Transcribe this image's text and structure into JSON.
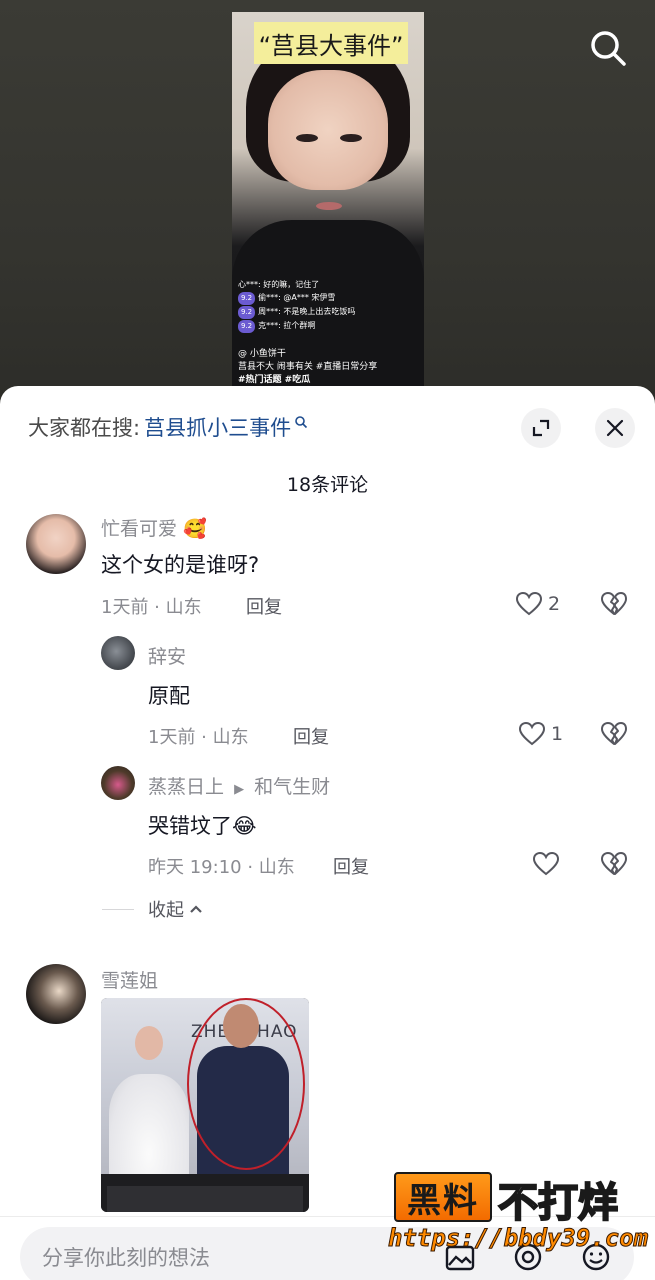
{
  "video": {
    "title_banner": "“莒县大事件”",
    "live_comments": [
      {
        "user": "心***:",
        "text": "好的嘛，记住了",
        "tag": ""
      },
      {
        "user": "偷***:",
        "text": "@A*** 宋伊雪",
        "tag": "9.2"
      },
      {
        "user": "周***:",
        "text": "不是晚上出去吃饭吗",
        "tag": "9.2"
      },
      {
        "user": "克***:",
        "text": "拉个群啊",
        "tag": "9.2"
      }
    ],
    "caption_user": "@ 小鱼饼干",
    "caption_line": "莒县不大 闹事有关 #直播日常分享",
    "caption_tags": "#热门话题 #吃瓜"
  },
  "sheet": {
    "search_label": "大家都在搜:",
    "search_keyword": "莒县抓小三事件",
    "comment_count": "18条评论",
    "collapse_label": "收起"
  },
  "comments": [
    {
      "username": "忙看可爱",
      "emoji": "🥰",
      "content": "这个女的是谁呀?",
      "meta": "1天前 · 山东",
      "reply": "回复",
      "likes": "2"
    },
    {
      "username": "辞安",
      "content": "原配",
      "meta": "1天前 · 山东",
      "reply": "回复",
      "likes": "1"
    },
    {
      "username": "蒸蒸日上",
      "reply_to": "和气生财",
      "content": "哭错坟了",
      "emoji": "😂",
      "meta": "昨天 19:10 · 山东",
      "reply": "回复",
      "likes": ""
    },
    {
      "username": "雪莲姐",
      "photo_text": "ZHENGHAO"
    }
  ],
  "input": {
    "placeholder": "分享你此刻的想法"
  },
  "watermark": {
    "box_text": "黑料",
    "text": "不打烊",
    "url": "https://bbdy39.com"
  },
  "colors": {
    "accent_blue": "#1f4d8f",
    "muted_text": "#8a8b91",
    "watermark_orange": "#f36b00"
  }
}
